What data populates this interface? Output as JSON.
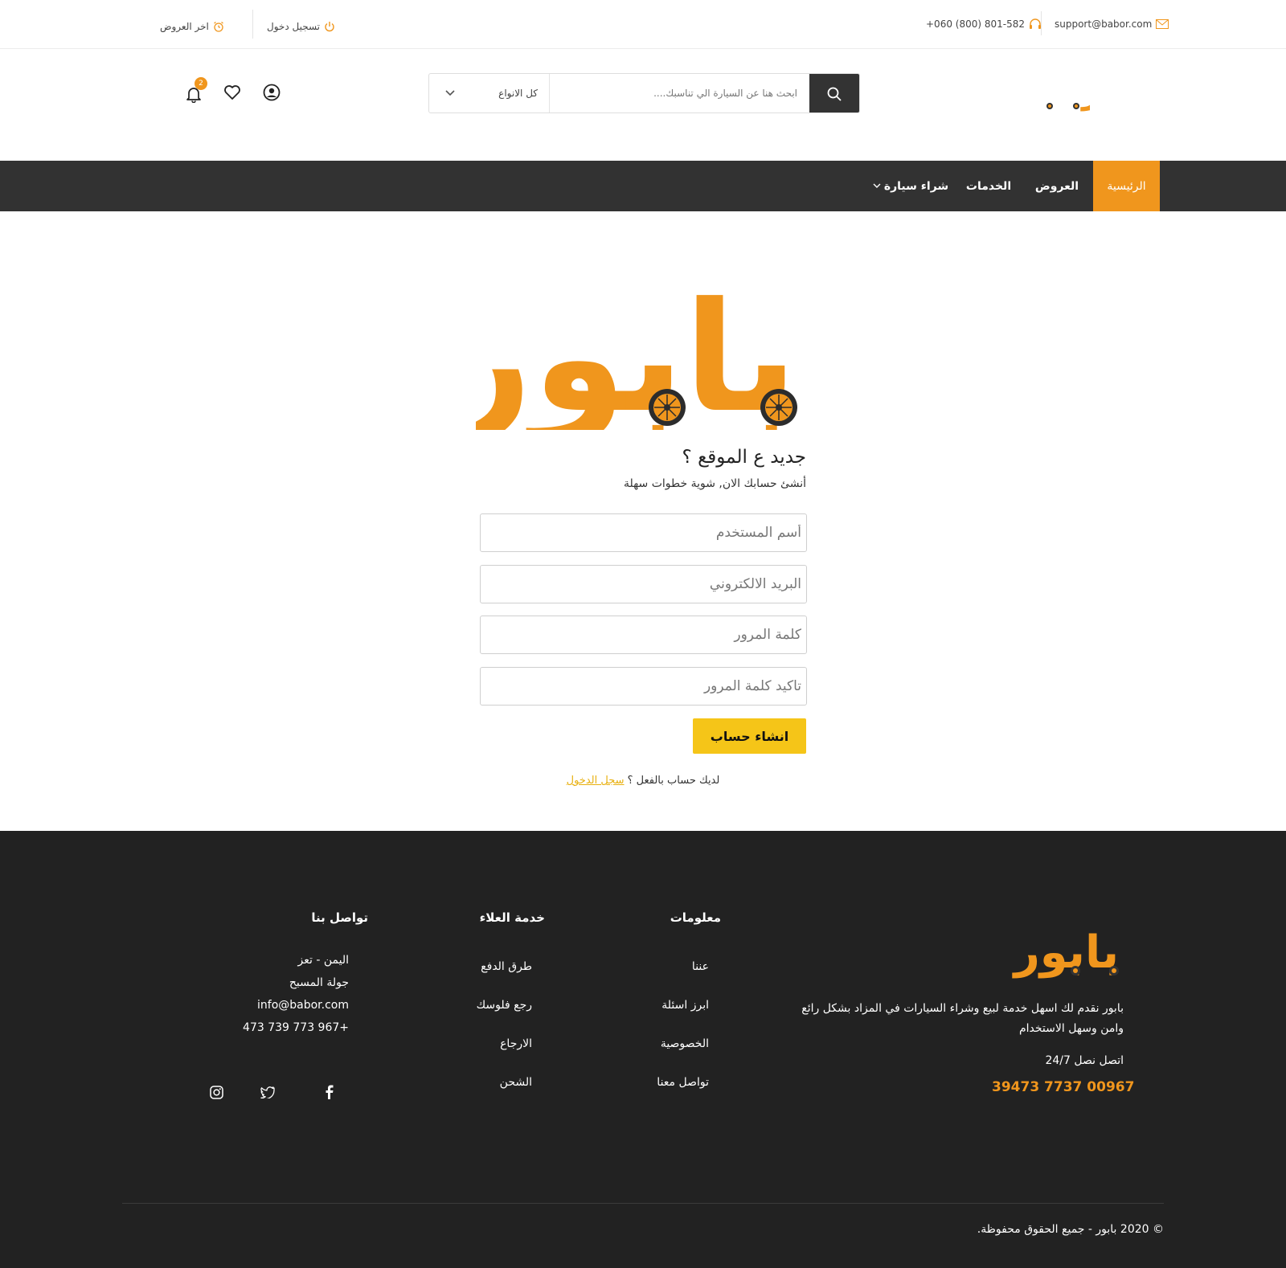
{
  "topbar": {
    "email": "support@babor.com",
    "email_icon": "mail-icon",
    "phone": "+060 (800) 801-582",
    "phone_icon": "headset-icon",
    "login_label": "تسجيل دخول",
    "login_icon": "power-icon",
    "offers_label": "اخر العروض",
    "offers_icon": "alarm-clock-icon"
  },
  "header": {
    "logo_text": "بابور",
    "search_placeholder": "ابحث هنا عن السيارة الي تناسبك....",
    "category_value": "كل الانواع",
    "notification_count": "2"
  },
  "nav": {
    "items": [
      {
        "label": "الرئيسية",
        "active": true
      },
      {
        "label": "العروض",
        "active": false
      },
      {
        "label": "الخدمات",
        "active": false
      },
      {
        "label": "شراء سيارة",
        "active": false
      }
    ]
  },
  "register": {
    "title": "جديد ع الموقع ؟",
    "subtitle": "أنشئ حسابك الان, شوية خطوات سهلة",
    "username_placeholder": "أسم المستخدم",
    "email_placeholder": "البريد الالكتروني",
    "password_placeholder": "كلمة المرور",
    "confirm_placeholder": "تاكيد كلمة المرور",
    "submit_label": "انشاء حساب",
    "have_account_text": "لديك حساب بالفعل ؟",
    "login_link": "سجل الدخول"
  },
  "footer": {
    "about_text_line1": "بابور نقدم لك اسهل خدمة لبيع وشراء السيارات في المزاد بشكل رائع",
    "about_text_line2": "وامن وسهل الاستخدام",
    "contact_label": "اتصل نصل 24/7",
    "contact_phone": "39473 7737 00967",
    "info_heading": "معلومات",
    "info_links": [
      "عننا",
      "ابرز اسئلة",
      "الخصوصية",
      "تواصل معنا"
    ],
    "service_heading": "خدمة العلاء",
    "service_links": [
      "طرق الدفع",
      "رجع فلوسك",
      "الارجاع",
      "الشحن"
    ],
    "contact_heading": "تواصل بنا",
    "address_line1": "اليمن - تعز",
    "address_line2": "جولة المسبح",
    "contact_email": "info@babor.com",
    "contact_number": "473 739 773 967+",
    "copyright": "© 2020 بابور - جميع الحقوق محفوظة.",
    "social": [
      "facebook-icon",
      "twitter-icon",
      "instagram-icon"
    ]
  },
  "colors": {
    "accent": "#f0961d",
    "nav_bg": "#323232",
    "footer_bg": "#222222",
    "button_yellow": "#f5c518"
  }
}
